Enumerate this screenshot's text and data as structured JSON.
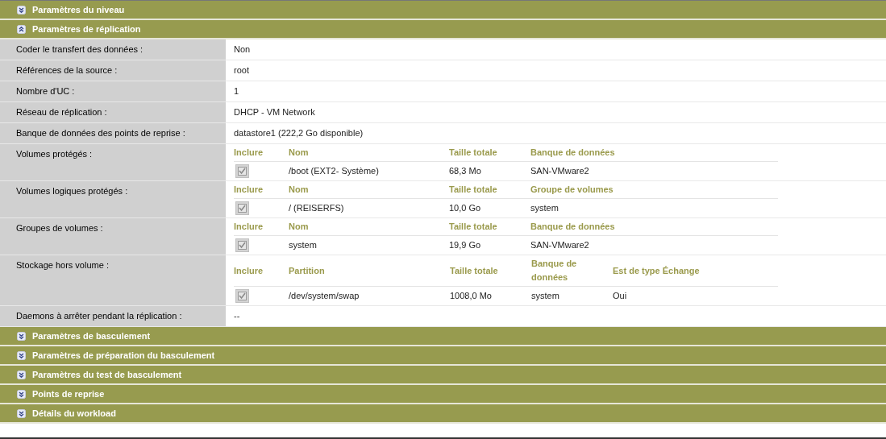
{
  "sections": [
    {
      "title": "Paramètres du niveau",
      "expanded": false
    },
    {
      "title": "Paramètres de réplication",
      "expanded": true,
      "fields": [
        {
          "label": "Coder le transfert des données :",
          "kind": "text",
          "value": "Non"
        },
        {
          "label": "Références de la source :",
          "kind": "text",
          "value": "root"
        },
        {
          "label": "Nombre d'UC :",
          "kind": "text",
          "value": "1"
        },
        {
          "label": "Réseau de réplication :",
          "kind": "text",
          "value": "DHCP - VM Network"
        },
        {
          "label": "Banque de données des points de reprise :",
          "kind": "text",
          "value": "datastore1 (222,2 Go disponible)"
        },
        {
          "label": "Volumes protégés :",
          "kind": "table",
          "columns": [
            "Inclure",
            "Nom",
            "Taille totale",
            "Banque de données"
          ],
          "rows": [
            {
              "checked": true,
              "disabled": true,
              "cells": [
                "",
                "/boot (EXT2- Système)",
                "68,3 Mo",
                "SAN-VMware2"
              ]
            }
          ]
        },
        {
          "label": "Volumes logiques protégés :",
          "kind": "table",
          "columns": [
            "Inclure",
            "Nom",
            "Taille totale",
            "Groupe de volumes"
          ],
          "rows": [
            {
              "checked": true,
              "disabled": true,
              "cells": [
                "",
                "/ (REISERFS)",
                "10,0 Go",
                "system"
              ]
            }
          ]
        },
        {
          "label": "Groupes de volumes :",
          "kind": "table",
          "columns": [
            "Inclure",
            "Nom",
            "Taille totale",
            "Banque de données"
          ],
          "rows": [
            {
              "checked": true,
              "disabled": true,
              "cells": [
                "",
                "system",
                "19,9 Go",
                "SAN-VMware2"
              ]
            }
          ]
        },
        {
          "label": "Stockage hors volume :",
          "kind": "table",
          "columns": [
            "Inclure",
            "Partition",
            "Taille totale",
            "Banque de données",
            "Est de type Échange"
          ],
          "rows": [
            {
              "checked": true,
              "disabled": true,
              "cells": [
                "",
                "/dev/system/swap",
                "1008,0 Mo",
                "system",
                "Oui"
              ]
            }
          ]
        },
        {
          "label": "Daemons à arrêter pendant la réplication :",
          "kind": "text",
          "value": "--"
        }
      ]
    },
    {
      "title": "Paramètres de basculement",
      "expanded": false
    },
    {
      "title": "Paramètres de préparation du basculement",
      "expanded": false
    },
    {
      "title": "Paramètres du test de basculement",
      "expanded": false
    },
    {
      "title": "Points de reprise",
      "expanded": false
    },
    {
      "title": "Détails du workload",
      "expanded": false
    }
  ]
}
